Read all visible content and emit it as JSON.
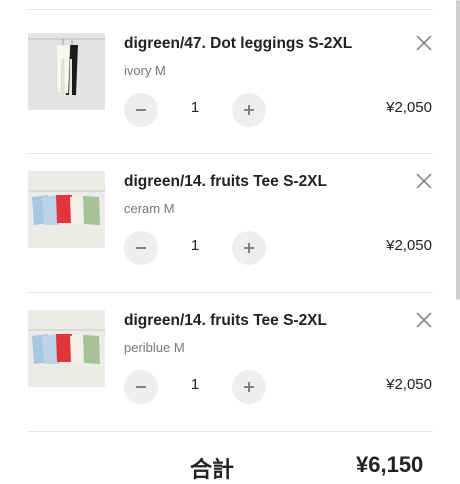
{
  "cart": {
    "items": [
      {
        "name": "digreen/47. Dot leggings S-2XL",
        "variant": "ivory M",
        "quantity": "1",
        "price": "¥2,050",
        "image_icon": "leggings-image"
      },
      {
        "name": "digreen/14. fruits Tee S-2XL",
        "variant": "ceram M",
        "quantity": "1",
        "price": "¥2,050",
        "image_icon": "tees-image"
      },
      {
        "name": "digreen/14. fruits Tee S-2XL",
        "variant": "periblue M",
        "quantity": "1",
        "price": "¥2,050",
        "image_icon": "tees-image"
      }
    ],
    "summary": {
      "label": "合計",
      "value": "¥6,150"
    }
  },
  "colors": {
    "divider": "#e6e6e6",
    "qty_button_bg": "#eeeeee",
    "variant_text": "#777777"
  }
}
